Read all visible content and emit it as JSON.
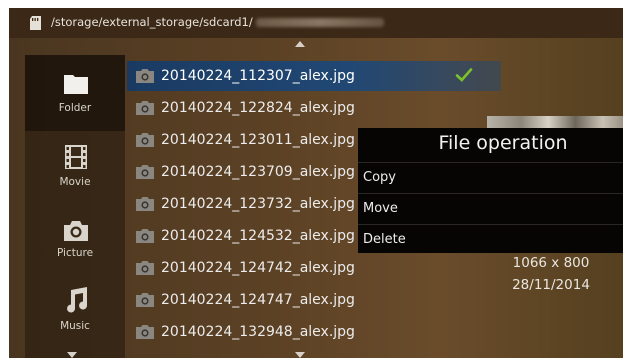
{
  "path_bar": {
    "path": "/storage/external_storage/sdcard1/",
    "icon": "sd-card-icon"
  },
  "sidebar": {
    "items": [
      {
        "label": "Folder",
        "icon": "folder-icon",
        "selected": true
      },
      {
        "label": "Movie",
        "icon": "film-icon",
        "selected": false
      },
      {
        "label": "Picture",
        "icon": "camera-icon",
        "selected": false
      },
      {
        "label": "Music",
        "icon": "music-note-icon",
        "selected": false
      }
    ]
  },
  "file_list": {
    "items": [
      {
        "name": "20140224_112307_alex.jpg",
        "selected": true,
        "checked": true
      },
      {
        "name": "20140224_122824_alex.jpg"
      },
      {
        "name": "20140224_123011_alex.jpg"
      },
      {
        "name": "20140224_123709_alex.jpg"
      },
      {
        "name": "20140224_123732_alex.jpg"
      },
      {
        "name": "20140224_124532_alex.jpg"
      },
      {
        "name": "20140224_124742_alex.jpg"
      },
      {
        "name": "20140224_124747_alex.jpg"
      },
      {
        "name": "20140224_132948_alex.jpg"
      }
    ]
  },
  "details": {
    "resolution": "1066 x 800",
    "date": "28/11/2014"
  },
  "file_operation": {
    "title": "File operation",
    "options": [
      "Copy",
      "Move",
      "Delete"
    ]
  },
  "colors": {
    "selection": "#214874",
    "check": "#7cc22a",
    "popup_bg": "#060504"
  }
}
